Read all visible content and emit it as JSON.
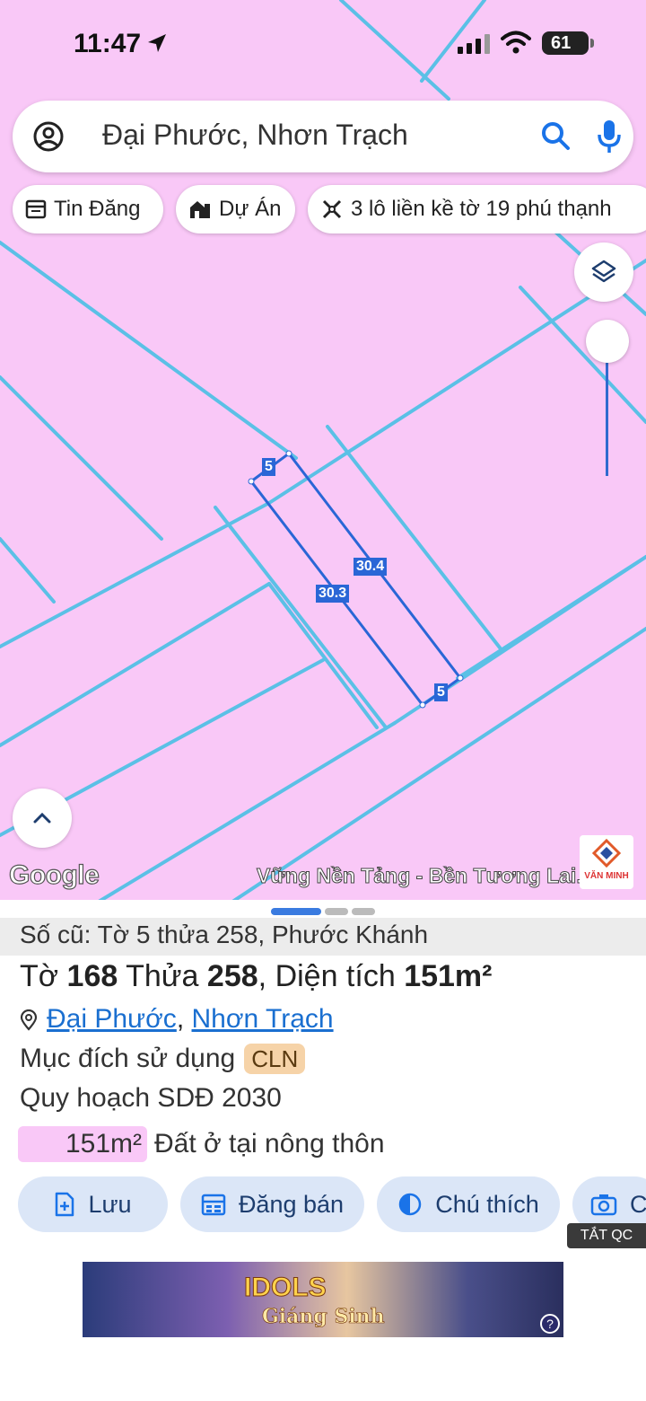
{
  "status_bar": {
    "time": "11:47",
    "battery": "61"
  },
  "search": {
    "query": "Đại Phước, Nhơn Trạch"
  },
  "chips": [
    {
      "label": "Tin Đăng",
      "icon": "listing-icon"
    },
    {
      "label": "Dự Án",
      "icon": "building-icon"
    },
    {
      "label": "3 lô liền kề tờ 19 phú thạnh",
      "icon": "measure-icon"
    }
  ],
  "map": {
    "dimension_labels": [
      "5",
      "30.4",
      "30.3",
      "5"
    ],
    "attribution": "Google",
    "slogan": "Vững Nền Tảng - Bền Tương Lai.",
    "brand": "VĂN MINH",
    "colors": {
      "land_fill": "#f9c8f7",
      "parcel_lines": "#5bc0e6",
      "selected_parcel": "#2a66d6"
    }
  },
  "sheet": {
    "old_info": "Số cũ: Tờ 5 thửa 258, Phước Khánh",
    "title": {
      "to_label": "Tờ",
      "to_value": "168",
      "thua_label": "Thửa",
      "thua_value": "258",
      "area_label": "Diện tích",
      "area_value": "151m²"
    },
    "address": {
      "ward": "Đại Phước",
      "separator": ",",
      "district": "Nhơn Trạch"
    },
    "purpose_label": "Mục đích sử dụng",
    "purpose_code": "CLN",
    "plan_label": "Quy hoạch SDĐ 2030",
    "land_use": {
      "area": "151m²",
      "type": "Đất ở tại nông thôn"
    }
  },
  "actions": [
    {
      "label": "Lưu",
      "icon": "save-icon"
    },
    {
      "label": "Đăng bán",
      "icon": "post-sale-icon"
    },
    {
      "label": "Chú thích",
      "icon": "legend-icon"
    },
    {
      "label": "C",
      "icon": "camera-icon"
    }
  ],
  "ad": {
    "close_label": "TẮT QC",
    "title": "IDOLS",
    "subtitle": "Giáng Sinh",
    "help": "?"
  }
}
